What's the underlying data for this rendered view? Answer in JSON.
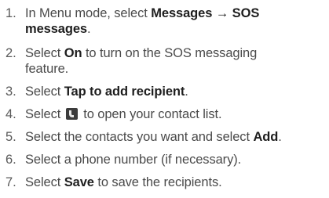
{
  "steps": [
    {
      "number": "1.",
      "line1_pre": "In Menu mode, select ",
      "line1_bold": "Messages → SOS",
      "line2_bold": "messages",
      "line2_post": "."
    },
    {
      "number": "2.",
      "line1_pre": "Select ",
      "line1_bold": "On",
      "line1_post": " to turn on the SOS messaging",
      "line2_post": "feature."
    },
    {
      "number": "3.",
      "pre": "Select ",
      "bold": "Tap to add recipient",
      "post": "."
    },
    {
      "number": "4.",
      "pre": "Select ",
      "icon": "contact-list-icon",
      "post": " to open your contact list."
    },
    {
      "number": "5.",
      "pre": "Select the contacts you want and select ",
      "bold": "Add",
      "post": "."
    },
    {
      "number": "6.",
      "pre": "Select a phone number (if necessary)."
    },
    {
      "number": "7.",
      "pre": "Select ",
      "bold": "Save",
      "post": " to save the recipients."
    }
  ]
}
